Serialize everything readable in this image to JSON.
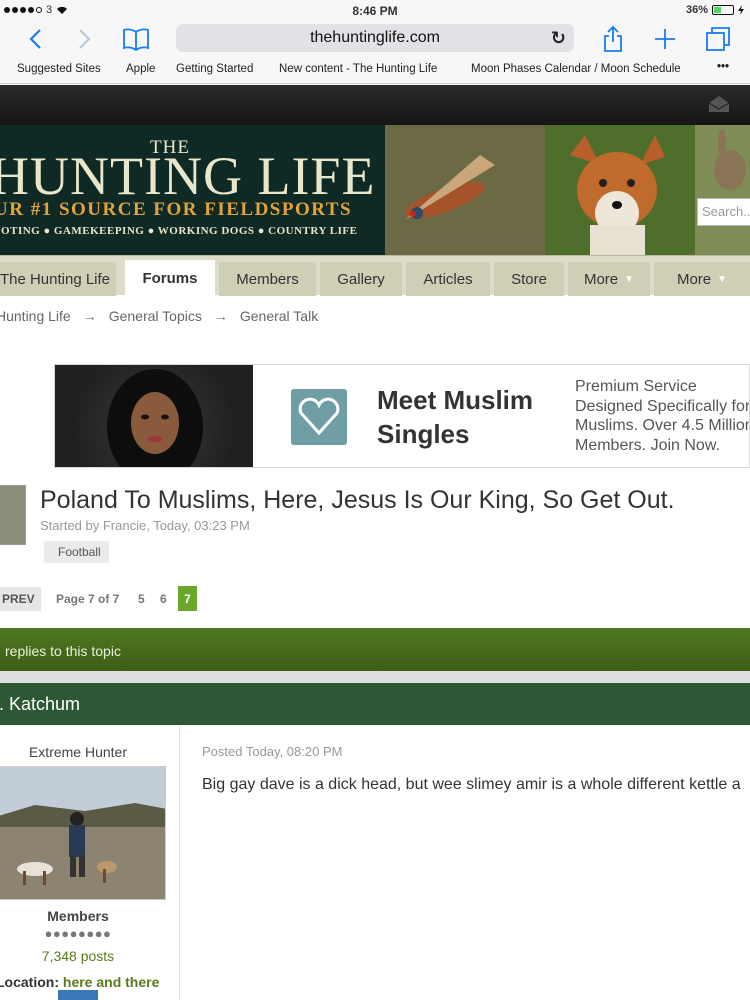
{
  "status_bar": {
    "carrier": "3",
    "time": "8:46 PM",
    "battery": "36%",
    "battery_level": 0.36
  },
  "browser": {
    "url": "thehuntinglife.com",
    "bookmarks": [
      "Suggested Sites",
      "Apple",
      "Getting Started",
      "New content - The Hunting Life",
      "Moon Phases Calendar / Moon Schedule",
      "•••"
    ]
  },
  "banner": {
    "the": "THE",
    "title": "HUNTING LIFE",
    "subtitle": "UR #1 SOURCE FOR FIELDSPORTS",
    "tags": "OOTING ● GAMEKEEPING ● WORKING DOGS ● COUNTRY LIFE",
    "search_placeholder": "Search..."
  },
  "nav": {
    "items": [
      {
        "label": "The Hunting Life"
      },
      {
        "label": "Forums"
      },
      {
        "label": "Members"
      },
      {
        "label": "Gallery"
      },
      {
        "label": "Articles"
      },
      {
        "label": "Store"
      },
      {
        "label": "More"
      },
      {
        "label": "More"
      }
    ]
  },
  "breadcrumb": [
    "Hunting Life",
    "General Topics",
    "General Talk"
  ],
  "ad": {
    "headline_1": "Meet Muslim",
    "headline_2": "Singles",
    "text": [
      "Premium Service",
      "Designed Specifically for",
      "Muslims. Over 4.5 Million",
      "Members. Join Now."
    ]
  },
  "topic": {
    "title": "Poland To Muslims, Here, Jesus Is Our King, So Get Out.",
    "meta": "Started by Francie, Today, 03:23 PM",
    "tag": "Football"
  },
  "pagination": {
    "prev": "PREV",
    "label": "Page 7 of 7",
    "pages": [
      "5",
      "6"
    ],
    "current": "7"
  },
  "replies_bar": "replies to this topic",
  "post": {
    "author": "/. Katchum",
    "rank": "Extreme Hunter",
    "group": "Members",
    "pips": "●●●●●●●●",
    "posts": "7,348 posts",
    "location_label": "Location:",
    "location_value": "here and there",
    "posted": "Posted Today, 08:20 PM",
    "body": "Big gay dave is a dick head, but wee slimey amir is a whole different kettle a"
  },
  "colors": {
    "ios_blue": "#1a7cf5",
    "green_bar": "#4f7720",
    "author_bar": "#2e5735",
    "page_current": "#6aa72a"
  }
}
